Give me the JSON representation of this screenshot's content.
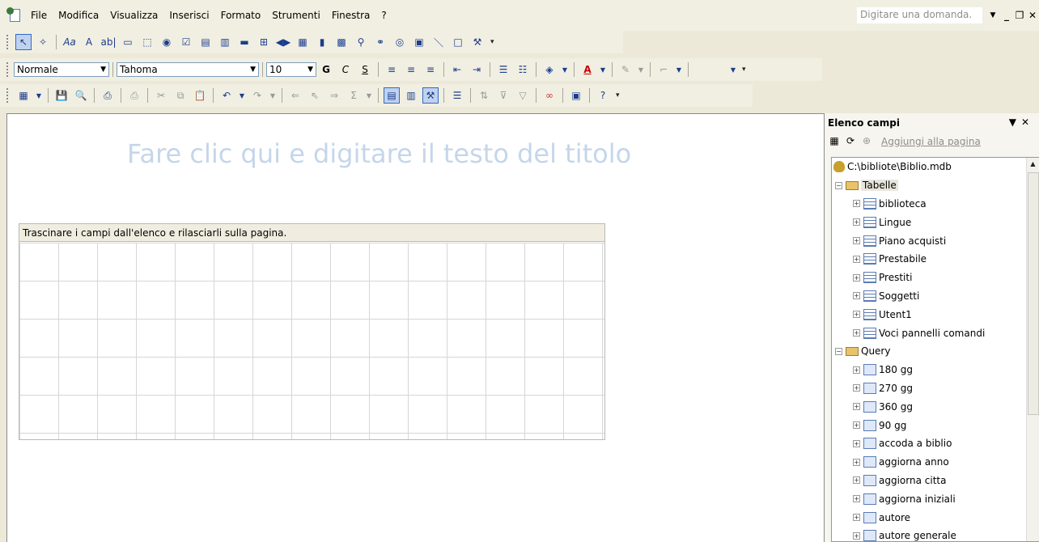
{
  "menubar": {
    "items": [
      "File",
      "Modifica",
      "Visualizza",
      "Inserisci",
      "Formato",
      "Strumenti",
      "Finestra",
      "?"
    ],
    "question_placeholder": "Digitare una domanda."
  },
  "toolbar_format": {
    "style": "Normale",
    "font": "Tahoma",
    "size": "10",
    "bold": "G",
    "italic": "C",
    "underline": "S"
  },
  "page": {
    "title_placeholder": "Fare clic qui e digitare il testo del titolo",
    "section_caption": "Trascinare i campi dall'elenco e rilasciarli sulla pagina."
  },
  "field_list": {
    "title": "Elenco campi",
    "add_to_page": "Aggiungi alla pagina",
    "database": "C:\\bibliote\\Biblio.mdb",
    "tables_label": "Tabelle",
    "tables": [
      "biblioteca",
      "Lingue",
      "Piano acquisti",
      "Prestabile",
      "Prestiti",
      "Soggetti",
      "Utent1",
      "Voci pannelli comandi"
    ],
    "queries_label": "Query",
    "queries": [
      "180 gg",
      "270 gg",
      "360 gg",
      "90 gg",
      "accoda a biblio",
      "aggiorna anno",
      "aggiorna citta",
      "aggiorna iniziali",
      "autore",
      "autore generale"
    ]
  }
}
